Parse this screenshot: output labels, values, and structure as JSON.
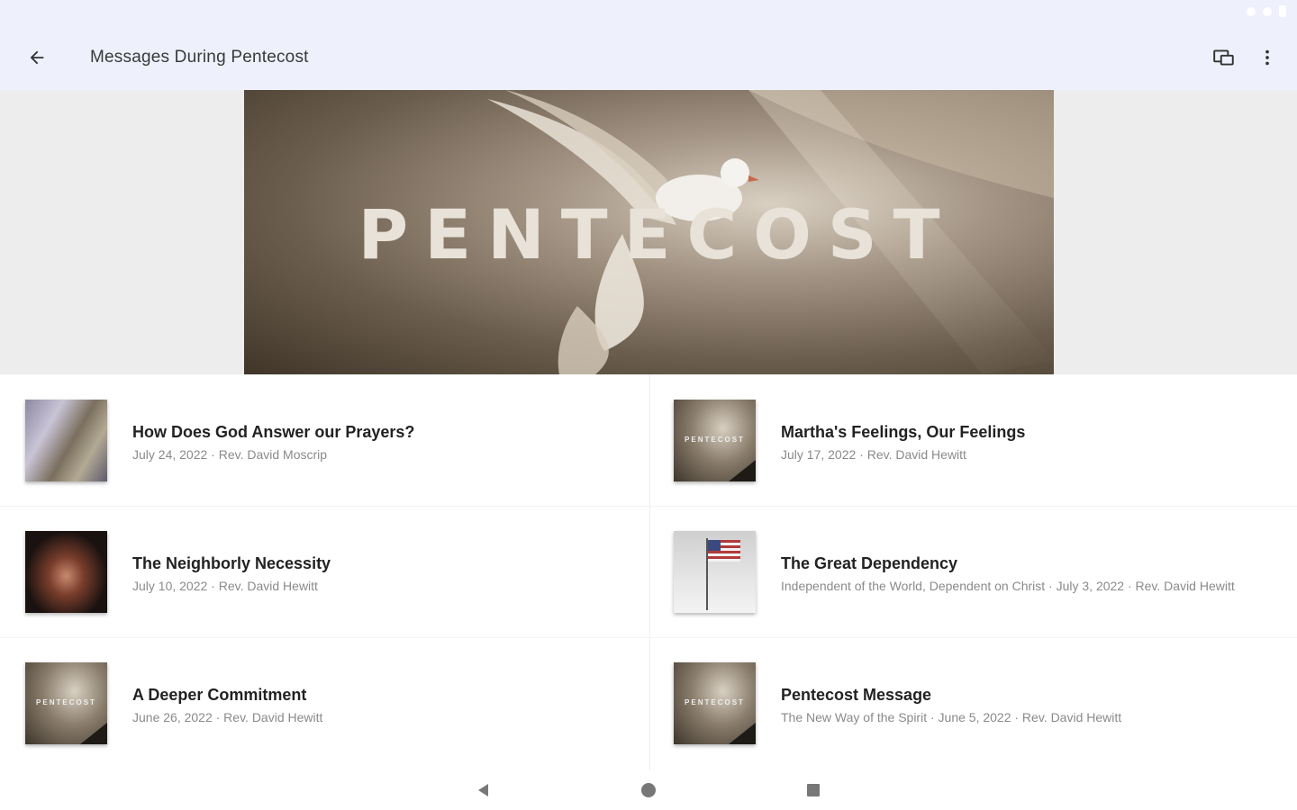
{
  "app_bar": {
    "title": "Messages During Pentecost",
    "icons": [
      "back-arrow-icon",
      "cast-icon",
      "more-vert-icon"
    ]
  },
  "hero": {
    "text": "PENTECOST"
  },
  "messages": [
    {
      "title": "How Does God Answer our Prayers?",
      "subtitle": "July 24, 2022 · Rev. David Moscrip"
    },
    {
      "title": "Martha's Feelings, Our Feelings",
      "subtitle": "July 17, 2022 · Rev. David Hewitt"
    },
    {
      "title": "The Neighborly Necessity",
      "subtitle": "July 10, 2022 · Rev. David Hewitt"
    },
    {
      "title": "The Great Dependency",
      "subtitle": "Independent of the World, Dependent on Christ · July 3, 2022 · Rev. David Hewitt"
    },
    {
      "title": "A Deeper Commitment",
      "subtitle": "June 26, 2022 · Rev. David Hewitt"
    },
    {
      "title": "Pentecost Message",
      "subtitle": "The New Way of the Spirit · June 5, 2022 · Rev. David Hewitt"
    }
  ],
  "thumb_text": "PENTECOST",
  "nav": {
    "icons": [
      "nav-back-icon",
      "nav-home-icon",
      "nav-recents-icon"
    ]
  },
  "colors": {
    "app_bar_bg": "#eef1fb",
    "hero_side_bg": "#ededed",
    "title_text": "#222222",
    "subtitle_text": "#8a8a8a"
  }
}
